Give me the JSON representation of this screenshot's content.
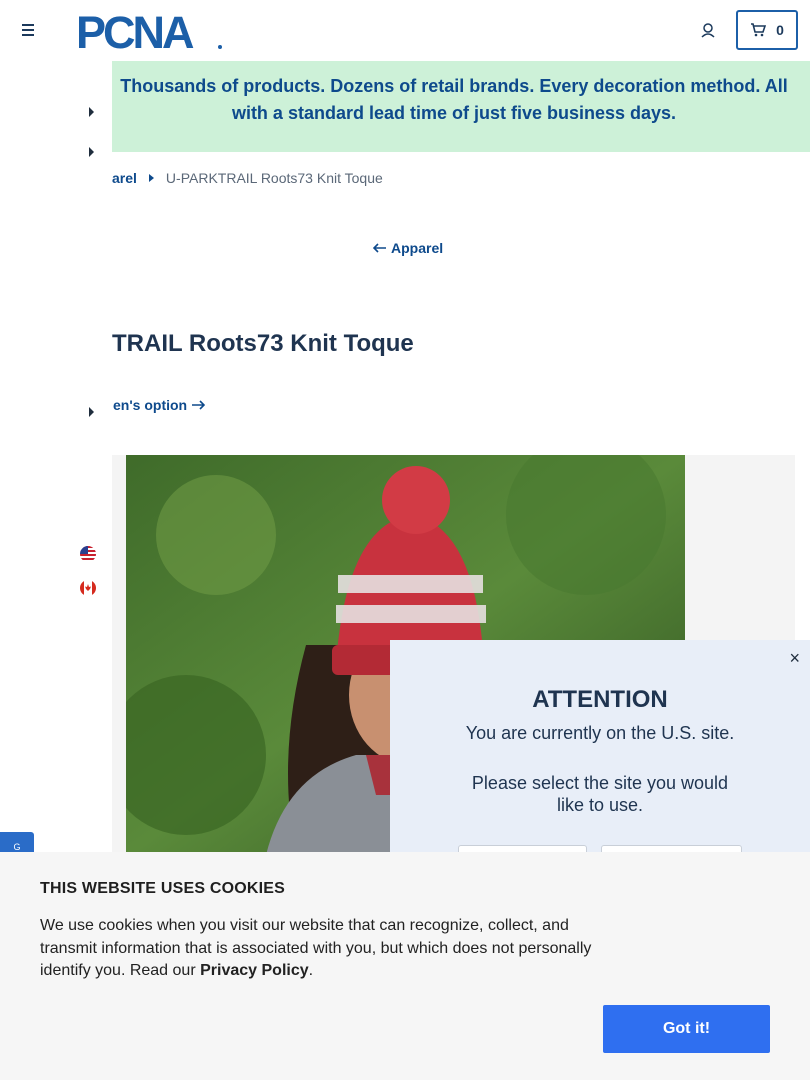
{
  "header": {
    "logo_text": "PCNA",
    "cart_count": "0"
  },
  "promo": {
    "line1": "Thousands of products. Dozens of retail brands. Every decoration method. All",
    "line2": "with a standard lead time of just five business days."
  },
  "breadcrumb": {
    "parent": "arel",
    "current": "U-PARKTRAIL Roots73 Knit Toque"
  },
  "back_link": {
    "label": "Apparel"
  },
  "product": {
    "title": "TRAIL Roots73 Knit Toque",
    "option_link": "en's option"
  },
  "attention": {
    "title": "ATTENTION",
    "line1": "You are currently on the U.S. site.",
    "line2": "Please select the site you would like to use.",
    "close": "×"
  },
  "side_tab": {
    "label": "G"
  },
  "cookie": {
    "title": "THIS WEBSITE USES COOKIES",
    "text": "We use cookies when you visit our website that can recognize, collect, and transmit information that is associated with you, but which does not personally identify you. Read our",
    "link": "Privacy Policy",
    "period": ".",
    "button": "Got it!"
  },
  "colors": {
    "brand_blue": "#0e4a8c",
    "promo_bg": "#cdf1d8",
    "button_blue": "#2f6ff0"
  }
}
